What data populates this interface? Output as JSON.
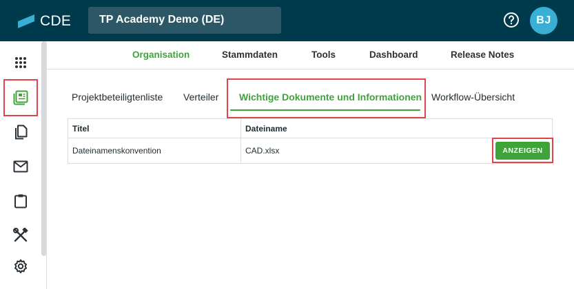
{
  "app": {
    "logo_text": "CDE",
    "project_name": "TP Academy Demo (DE)",
    "user_initials": "BJ"
  },
  "colors": {
    "header_bg": "#003b4d",
    "accent_green": "#3ea43a",
    "highlight_red": "#e0434a",
    "avatar_bg": "#3aafd6",
    "logo_accent": "#3aafd6"
  },
  "sidebar": {
    "items": [
      {
        "icon": "apps-grid-icon"
      },
      {
        "icon": "document-list-icon",
        "active": true
      },
      {
        "icon": "copy-documents-icon"
      },
      {
        "icon": "mail-icon"
      },
      {
        "icon": "clipboard-icon"
      },
      {
        "icon": "tools-icon"
      },
      {
        "icon": "gear-icon"
      }
    ]
  },
  "mainnav": {
    "items": [
      {
        "label": "Organisation",
        "active": true
      },
      {
        "label": "Stammdaten"
      },
      {
        "label": "Tools"
      },
      {
        "label": "Dashboard"
      },
      {
        "label": "Release Notes"
      }
    ]
  },
  "subtabs": {
    "items": [
      {
        "label": "Projektbeteiligtenliste"
      },
      {
        "label": "Verteiler"
      },
      {
        "label": "Wichtige Dokumente und Informationen",
        "active": true
      },
      {
        "label": "Workflow-Übersicht"
      }
    ]
  },
  "table": {
    "headers": [
      "Titel",
      "Dateiname"
    ],
    "rows": [
      {
        "title": "Dateinamenskonvention",
        "filename": "CAD.xlsx",
        "action_label": "ANZEIGEN"
      }
    ]
  }
}
